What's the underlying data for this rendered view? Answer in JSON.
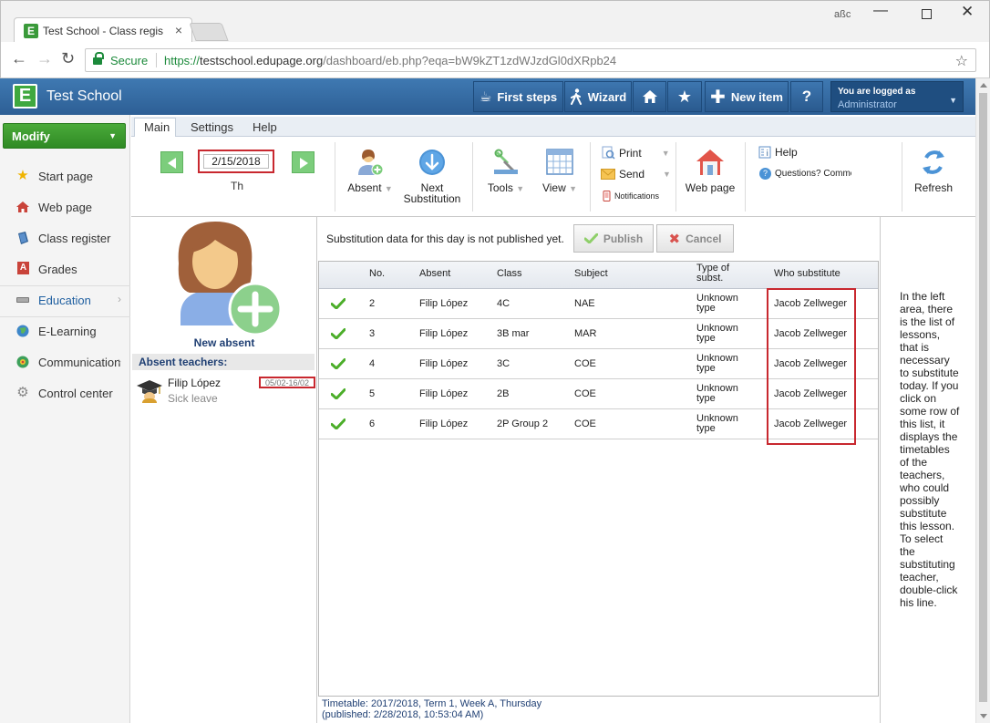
{
  "browser": {
    "tab_title": "Test School - Class regist",
    "tab_close": "×",
    "favicon": "E",
    "window_user": "aßc",
    "secure_label": "Secure",
    "url_protocol": "https://",
    "url_host": "testschool.edupage.org",
    "url_path": "/dashboard/eb.php?eqa=bW9kZT1zdWJzdGl0dXRpb24"
  },
  "header": {
    "logo": "E",
    "school_name": "Test School",
    "buttons": [
      {
        "label": "First steps",
        "icon": "cup-icon"
      },
      {
        "label": "Wizard",
        "icon": "walker-icon"
      },
      {
        "label": "",
        "icon": "home-icon"
      },
      {
        "label": "",
        "icon": "star-icon"
      },
      {
        "label": "New item",
        "icon": "plus-icon"
      },
      {
        "label": "?",
        "icon": "help-icon"
      }
    ],
    "user": {
      "line1": "You are logged as",
      "line2": "Administrator"
    }
  },
  "sidebar": {
    "modify_label": "Modify",
    "items": [
      {
        "label": "Start page",
        "icon": "star-icon",
        "has_arrow": false
      },
      {
        "label": "Web page",
        "icon": "house-icon",
        "has_arrow": false
      },
      {
        "label": "Class register",
        "icon": "book-icon",
        "has_arrow": false
      },
      {
        "label": "Grades",
        "icon": "grades-icon",
        "has_arrow": false
      },
      {
        "label": "Education",
        "icon": "education-icon",
        "has_arrow": true
      },
      {
        "label": "E-Learning",
        "icon": "globe-icon",
        "has_arrow": false
      },
      {
        "label": "Communication",
        "icon": "communication-icon",
        "has_arrow": true
      },
      {
        "label": "Control center",
        "icon": "gear-icon",
        "has_arrow": false
      }
    ]
  },
  "ribbon": {
    "tabs": [
      "Main",
      "Settings",
      "Help"
    ],
    "active_tab": "Main",
    "date_value": "2/15/2018",
    "day": "Th",
    "absent_label": "Absent",
    "next_label_1": "Next",
    "next_label_2": "Substitution",
    "tools_label": "Tools",
    "view_label": "View",
    "print_label": "Print",
    "send_label": "Send",
    "notifications_label": "Notifications",
    "webpage_label": "Web page",
    "help_label": "Help",
    "questions_label": "Questions? Commen",
    "refresh_label": "Refresh"
  },
  "left_panel": {
    "new_absent_label": "New absent",
    "absent_header": "Absent teachers:",
    "absent_teachers": [
      {
        "name": "Filip López",
        "reason": "Sick leave",
        "dates": "05/02-16/02"
      }
    ]
  },
  "main": {
    "notice": "Substitution data for this day is not published yet.",
    "publish_label": "Publish",
    "cancel_label": "Cancel",
    "columns": {
      "no": "No.",
      "absent": "Absent",
      "class": "Class",
      "subject": "Subject",
      "type_1": "Type of",
      "type_2": "subst.",
      "who": "Who substitute"
    },
    "rows": [
      {
        "no": "2",
        "absent": "Filip López",
        "class": "4C",
        "subject": "NAE",
        "type_1": "Unknown",
        "type_2": "type",
        "who": "Jacob Zellweger"
      },
      {
        "no": "3",
        "absent": "Filip López",
        "class": "3B mar",
        "subject": "MAR",
        "type_1": "Unknown",
        "type_2": "type",
        "who": "Jacob Zellweger"
      },
      {
        "no": "4",
        "absent": "Filip López",
        "class": "3C",
        "subject": "COE",
        "type_1": "Unknown",
        "type_2": "type",
        "who": "Jacob Zellweger"
      },
      {
        "no": "5",
        "absent": "Filip López",
        "class": "2B",
        "subject": "COE",
        "type_1": "Unknown",
        "type_2": "type",
        "who": "Jacob Zellweger"
      },
      {
        "no": "6",
        "absent": "Filip López",
        "class": "2P Group 2",
        "subject": "COE",
        "type_1": "Unknown",
        "type_2": "type",
        "who": "Jacob Zellweger"
      }
    ],
    "timetable_line": "Timetable: 2017/2018, Term 1, Week A, Thursday",
    "published_line": "(published: 2/28/2018, 10:53:04 AM)"
  },
  "help_text": "In the left area, there is the list of lessons, that is necessary to substitute today. If you click on some row of this list, it displays the timetables of the teachers, who could possibly substitute this lesson. To select the substituting teacher, double-click his line."
}
